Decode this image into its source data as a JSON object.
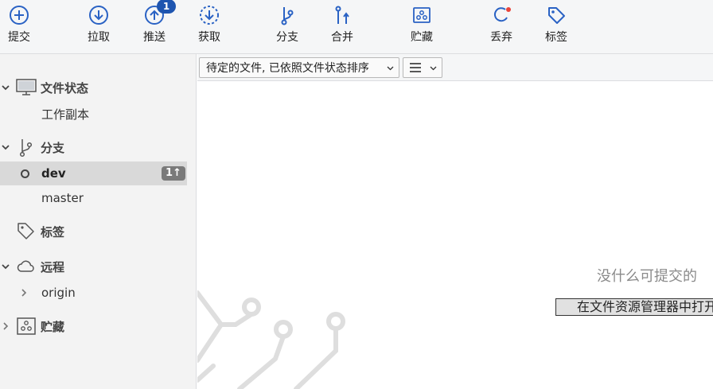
{
  "toolbar": {
    "commit": "提交",
    "pull": "拉取",
    "push": "推送",
    "push_badge": "1",
    "fetch": "获取",
    "branch": "分支",
    "merge": "合并",
    "stash": "贮藏",
    "discard": "丢弃",
    "tag": "标签"
  },
  "sidebar": {
    "file_status": {
      "label": "文件状态",
      "items": [
        "工作副本"
      ]
    },
    "branches": {
      "label": "分支",
      "items": [
        {
          "name": "dev",
          "ahead": "1↑",
          "current": true
        },
        {
          "name": "master"
        }
      ]
    },
    "tags": {
      "label": "标签"
    },
    "remotes": {
      "label": "远程",
      "items": [
        "origin"
      ]
    },
    "stashes": {
      "label": "贮藏"
    }
  },
  "main": {
    "filter_select": "待定的文件, 已依照文件状态排序",
    "empty_text": "没什么可提交的",
    "open_explorer_button": "在文件资源管理器中打开"
  },
  "colors": {
    "accent": "#1e55b0",
    "discard_dot": "#e8443a",
    "icon_blue": "#2a62c4"
  }
}
